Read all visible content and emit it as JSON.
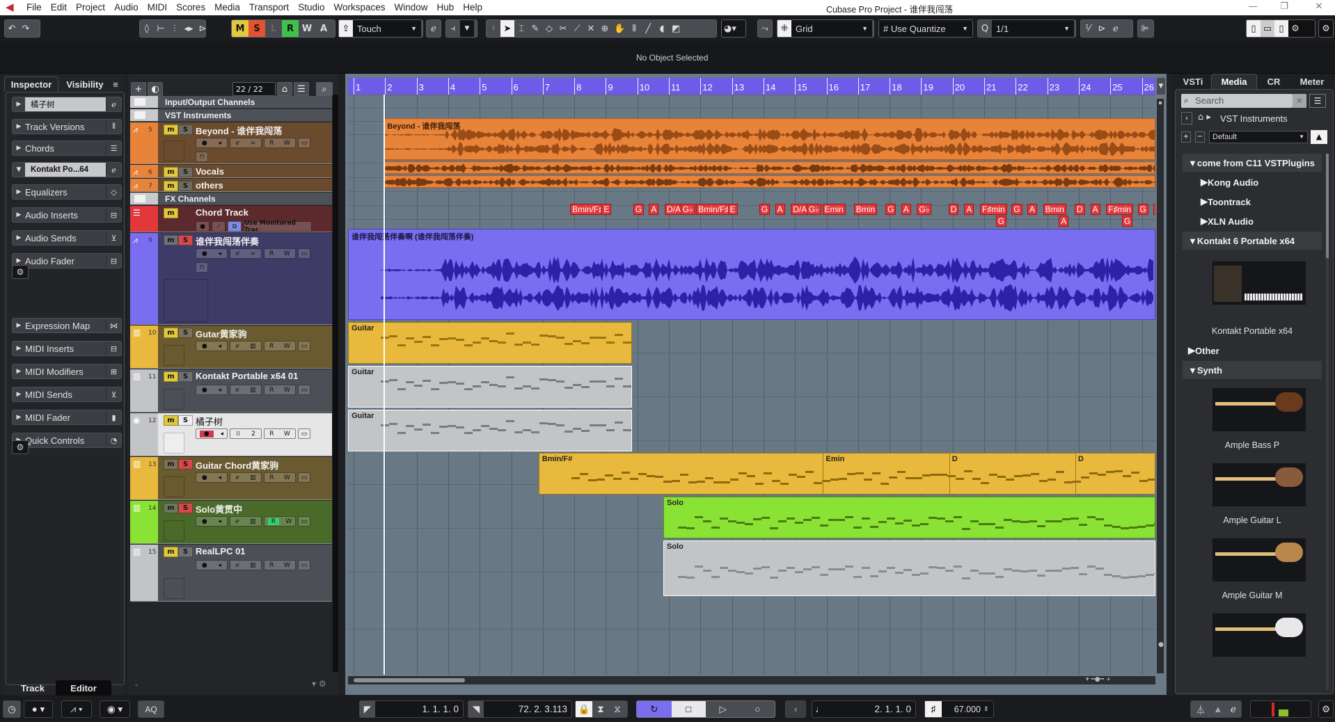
{
  "app": {
    "title": "Cubase Pro Project - 谁伴我闯荡",
    "menu": [
      "File",
      "Edit",
      "Project",
      "Audio",
      "MIDI",
      "Scores",
      "Media",
      "Transport",
      "Studio",
      "Workspaces",
      "Window",
      "Hub",
      "Help"
    ]
  },
  "toolbar": {
    "msl": [
      "M",
      "S",
      "L",
      "R",
      "W",
      "A"
    ],
    "automation_mode": "Touch",
    "snap_type": "Grid",
    "grid_type": "Use Quantize",
    "quantize": "1/1"
  },
  "infoline": {
    "status": "No Object Selected"
  },
  "inspector": {
    "tabs": [
      "Inspector",
      "Visibility"
    ],
    "track_name": "橘子树",
    "sections": [
      "Track Versions",
      "Chords"
    ],
    "instrument": "Kontakt Po...64",
    "audio_sections": [
      "Equalizers",
      "Audio Inserts",
      "Audio Sends",
      "Audio Fader"
    ],
    "midi_sections": [
      "Expression Map",
      "MIDI Inserts",
      "MIDI Modifiers",
      "MIDI Sends",
      "MIDI Fader",
      "Quick Controls"
    ],
    "bottom_tabs": [
      "Track",
      "Editor"
    ]
  },
  "tracklist": {
    "count": "22 / 22",
    "footer": "-",
    "folders": {
      "io": "Input/Output Channels",
      "vsti": "VST Instruments",
      "fx": "FX Channels"
    },
    "tracks": [
      {
        "num": "5",
        "name": "Beyond - 谁伴我闯荡"
      },
      {
        "num": "6",
        "name": "Vocals"
      },
      {
        "num": "7",
        "name": "others"
      },
      {
        "num": "",
        "name": "Chord Track",
        "monitor": "Use Monitored Trac"
      },
      {
        "num": "9",
        "name": "谁伴我闯荡伴奏"
      },
      {
        "num": "10",
        "name": "Gutar黄家驹"
      },
      {
        "num": "11",
        "name": "Kontakt Portable x64 01"
      },
      {
        "num": "12",
        "name": "橘子树",
        "midi_channel": "2"
      },
      {
        "num": "13",
        "name": "Guitar Chord黄家驹"
      },
      {
        "num": "14",
        "name": "Solo黄贯中"
      },
      {
        "num": "15",
        "name": "RealLPC 01"
      }
    ]
  },
  "ruler": {
    "bars": [
      "1",
      "2",
      "3",
      "4",
      "5",
      "6",
      "7",
      "8",
      "9",
      "10",
      "11",
      "12",
      "13",
      "14",
      "15",
      "16",
      "17",
      "18",
      "19",
      "20",
      "21",
      "22",
      "23",
      "24",
      "25",
      "26"
    ]
  },
  "regions": {
    "beyond": "Beyond - 谁伴我闯荡",
    "accomp": "谁伴我闯荡伴奏啊 (谁伴我闯荡伴奏)",
    "guitar": "Guitar",
    "chord_parts": [
      "Bmin/F#",
      "Emin",
      "D",
      "D"
    ],
    "solo": "Solo"
  },
  "chord_events": [
    {
      "bar": 8.0,
      "label": "Bmin/F♯",
      "row": 0
    },
    {
      "bar": 9.0,
      "label": "E",
      "row": 0
    },
    {
      "bar": 10.0,
      "label": "G",
      "row": 0
    },
    {
      "bar": 10.5,
      "label": "A",
      "row": 0
    },
    {
      "bar": 11.0,
      "label": "D/A",
      "row": 0
    },
    {
      "bar": 11.5,
      "label": "G♭",
      "row": 0
    },
    {
      "bar": 12.0,
      "label": "Bmin/F♯",
      "row": 0
    },
    {
      "bar": 13.0,
      "label": "E",
      "row": 0
    },
    {
      "bar": 14.0,
      "label": "G",
      "row": 0
    },
    {
      "bar": 14.5,
      "label": "A",
      "row": 0
    },
    {
      "bar": 15.0,
      "label": "D/A",
      "row": 0
    },
    {
      "bar": 15.5,
      "label": "G♭",
      "row": 0
    },
    {
      "bar": 16.0,
      "label": "Emin",
      "row": 0
    },
    {
      "bar": 17.0,
      "label": "Bmin",
      "row": 0
    },
    {
      "bar": 18.0,
      "label": "G",
      "row": 0
    },
    {
      "bar": 18.5,
      "label": "A",
      "row": 0
    },
    {
      "bar": 19.0,
      "label": "G♭",
      "row": 0
    },
    {
      "bar": 20.0,
      "label": "D",
      "row": 0
    },
    {
      "bar": 20.5,
      "label": "A",
      "row": 0
    },
    {
      "bar": 21.0,
      "label": "F♯min",
      "row": 0
    },
    {
      "bar": 21.5,
      "label": "G",
      "row": 1
    },
    {
      "bar": 22.0,
      "label": "G",
      "row": 0
    },
    {
      "bar": 22.5,
      "label": "A",
      "row": 0
    },
    {
      "bar": 23.0,
      "label": "Bmin",
      "row": 0
    },
    {
      "bar": 23.5,
      "label": "A",
      "row": 1
    },
    {
      "bar": 24.0,
      "label": "D",
      "row": 0
    },
    {
      "bar": 24.5,
      "label": "A",
      "row": 0
    },
    {
      "bar": 25.0,
      "label": "F♯min",
      "row": 0
    },
    {
      "bar": 25.5,
      "label": "G",
      "row": 1
    },
    {
      "bar": 26.0,
      "label": "G",
      "row": 0
    },
    {
      "bar": 26.5,
      "label": "A",
      "row": 0
    }
  ],
  "mediabay": {
    "tabs": [
      "VSTi",
      "Media",
      "CR",
      "Meter"
    ],
    "search_placeholder": "Search",
    "path": "VST Instruments",
    "preset": "Default",
    "tree": [
      {
        "label": "come from C11 VSTPlugins",
        "expanded": true,
        "level": 0
      },
      {
        "label": "Kong Audio",
        "expanded": false,
        "level": 1
      },
      {
        "label": "Toontrack",
        "expanded": false,
        "level": 1
      },
      {
        "label": "XLN Audio",
        "expanded": false,
        "level": 1
      },
      {
        "label": "Kontakt 6 Portable x64",
        "expanded": true,
        "level": 0
      }
    ],
    "kontakt_item": "Kontakt Portable x64",
    "tree2": [
      {
        "label": "Other",
        "expanded": false
      },
      {
        "label": "Synth",
        "expanded": true
      }
    ],
    "synth_items": [
      "Ample Bass P",
      "Ample Guitar L",
      "Ample Guitar M"
    ]
  },
  "transport": {
    "left_locator": "1. 1. 1.   0",
    "right_locator": "72. 2. 3.113",
    "position": "2. 1. 1.   0",
    "tempo": "67.000",
    "aq": "AQ"
  },
  "colors": {
    "ruler": "#6e5be8",
    "audio_orange": "#e8833a",
    "accomp_purple": "#7a6ef0",
    "guitar_yellow": "#e8b93c",
    "solo_green": "#8ae234",
    "chord_red": "#e2373b",
    "midi_gray": "#c3c4c6"
  }
}
